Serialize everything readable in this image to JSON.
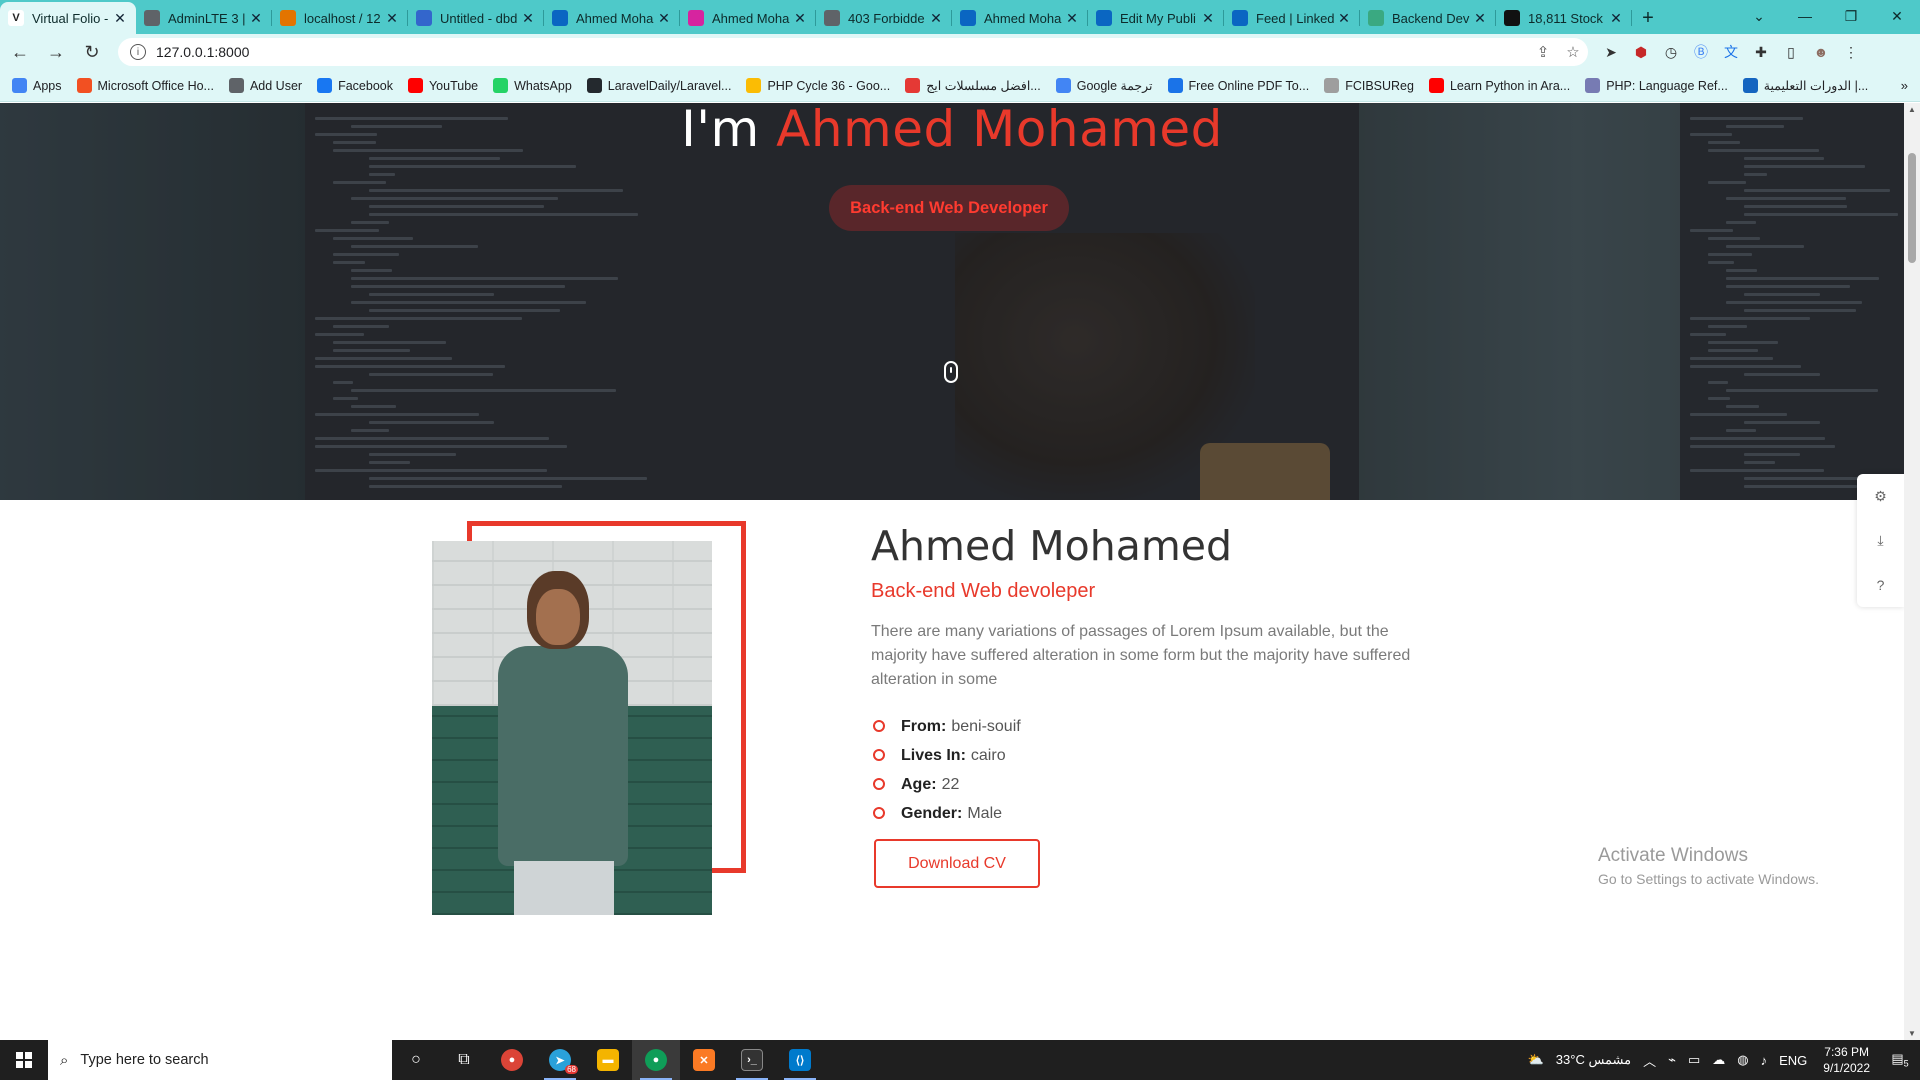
{
  "browser": {
    "tabs": [
      {
        "title": "Virtual Folio -",
        "icon": "v-logo-icon",
        "color": "#ffffff"
      },
      {
        "title": "AdminLTE 3 |",
        "icon": "globe-icon",
        "color": "#5f6368"
      },
      {
        "title": "localhost / 12",
        "icon": "pma-icon",
        "color": "#e37400"
      },
      {
        "title": "Untitled - dbd",
        "icon": "dbdiagram-icon",
        "color": "#3366cc"
      },
      {
        "title": "Ahmed Moha",
        "icon": "linkedin-icon",
        "color": "#0a66c2"
      },
      {
        "title": "Ahmed Moha",
        "icon": "instagram-icon",
        "color": "#d6249f"
      },
      {
        "title": "403 Forbidde",
        "icon": "globe-icon",
        "color": "#5f6368"
      },
      {
        "title": "Ahmed Moha",
        "icon": "linkedin-icon",
        "color": "#0a66c2"
      },
      {
        "title": "Edit My Publi",
        "icon": "linkedin-icon",
        "color": "#0a66c2"
      },
      {
        "title": "Feed | Linked",
        "icon": "linkedin-icon",
        "color": "#0a66c2"
      },
      {
        "title": "Backend Dev",
        "icon": "d-logo-icon",
        "color": "#3aa981"
      },
      {
        "title": "18,811 Stock",
        "icon": "s-logo-icon",
        "color": "#111111"
      }
    ],
    "tab_close": "✕",
    "new_tab": "+",
    "url": "127.0.0.1:8000",
    "bookmarks": [
      {
        "label": "Apps",
        "color": "#4285f4"
      },
      {
        "label": "Microsoft Office Ho...",
        "color": "#f25022"
      },
      {
        "label": "Add User",
        "color": "#5f6368"
      },
      {
        "label": "Facebook",
        "color": "#1877f2"
      },
      {
        "label": "YouTube",
        "color": "#ff0000"
      },
      {
        "label": "WhatsApp",
        "color": "#25d366"
      },
      {
        "label": "LaravelDaily/Laravel...",
        "color": "#24292e"
      },
      {
        "label": "PHP Cycle 36 - Goo...",
        "color": "#fbbc04"
      },
      {
        "label": "افضل مسلسلات ايج...",
        "color": "#e53935"
      },
      {
        "label": "Google ترجمة",
        "color": "#4285f4"
      },
      {
        "label": "Free Online PDF To...",
        "color": "#1a73e8"
      },
      {
        "label": "FCIBSUReg",
        "color": "#9e9e9e"
      },
      {
        "label": "Learn Python in Ara...",
        "color": "#ff0000"
      },
      {
        "label": "PHP: Language Ref...",
        "color": "#777bb3"
      },
      {
        "label": "الدورات التعليمية |...",
        "color": "#1565c0"
      }
    ],
    "bookmarks_more": "»"
  },
  "hero": {
    "title_prefix": "I'm ",
    "title_name": "Ahmed Mohamed",
    "role_pill": "Back-end Web Developer"
  },
  "about": {
    "name": "Ahmed Mohamed",
    "role": "Back-end Web devoleper",
    "description": "There are many variations of passages of Lorem Ipsum available, but the majority have suffered alteration in some form but the majority have suffered alteration in some",
    "facts": [
      {
        "label": "From:",
        "value": "beni-souif"
      },
      {
        "label": "Lives In:",
        "value": "cairo"
      },
      {
        "label": "Age:",
        "value": "22"
      },
      {
        "label": "Gender:",
        "value": "Male"
      }
    ],
    "cv_button": "Download CV",
    "accent_color": "#e8392b"
  },
  "side_tools": [
    "gear-icon",
    "download-icon",
    "help-icon"
  ],
  "watermark": {
    "line1": "Activate Windows",
    "line2": "Go to Settings to activate Windows."
  },
  "taskbar": {
    "search_placeholder": "Type here to search",
    "weather": "33°C مشمس",
    "lang": "ENG",
    "time": "7:36 PM",
    "date": "9/1/2022",
    "telegram_badge": "68",
    "notifications": "5"
  }
}
